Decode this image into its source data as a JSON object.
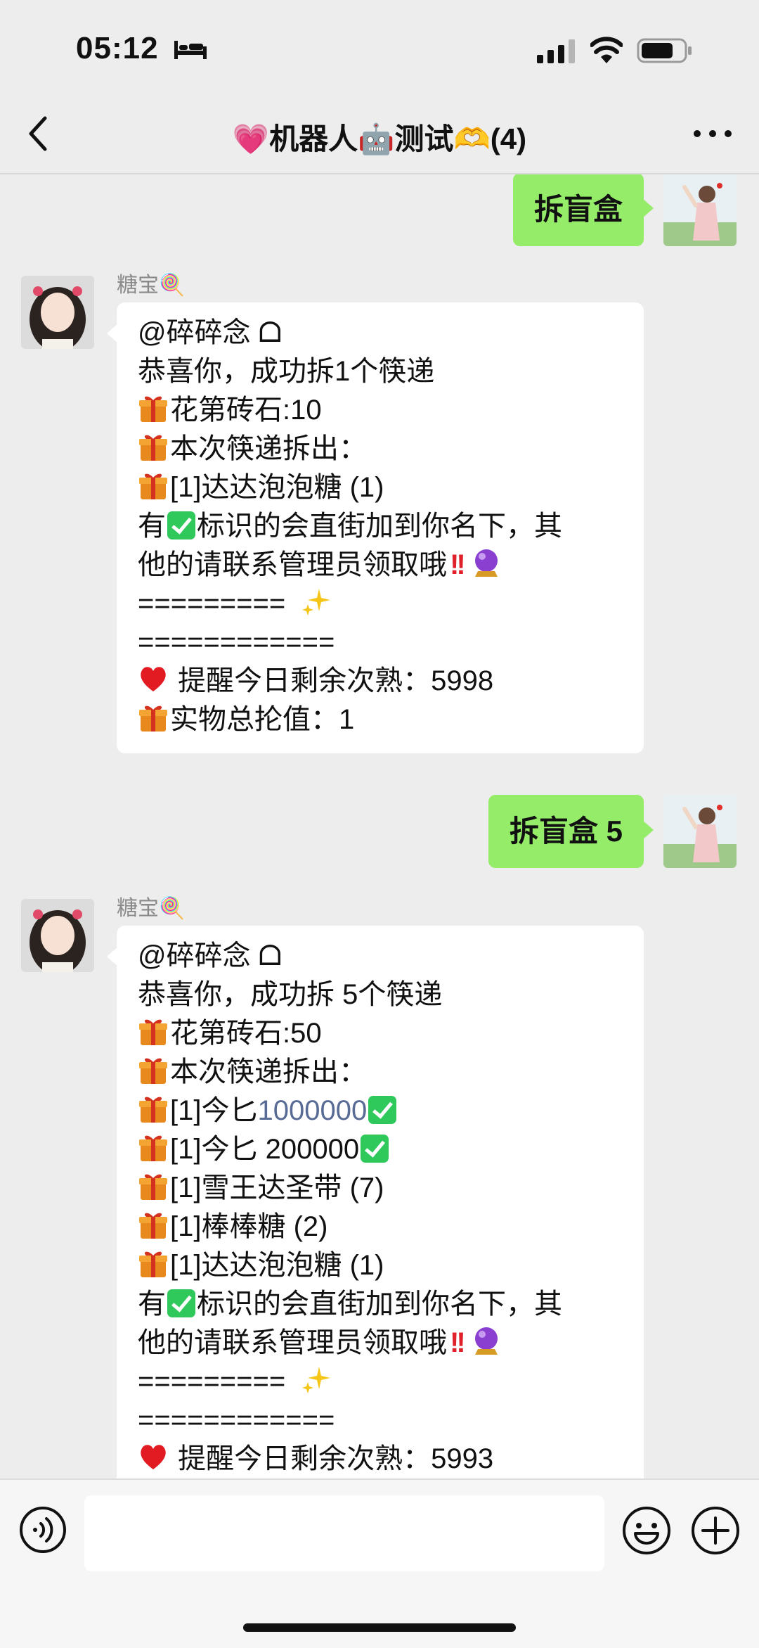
{
  "status": {
    "time": "05:12"
  },
  "nav": {
    "title": "💗机器人🤖测试🫶(4)"
  },
  "messages": [
    {
      "type": "out",
      "text": "拆盲盒"
    },
    {
      "type": "in",
      "sender": "糖宝🍭",
      "lines": [
        "@碎碎念 ᗝ",
        "恭喜你，成功拆1个筷递",
        "花第砖石:10",
        "本次筷递拆出：",
        "[1]达达泡泡糖 (1)",
        "有",
        "标识的会直街加到你名下，其",
        "他的请联系管理员领取哦",
        "=========",
        "============",
        "提醒今日剩余次熟：5998",
        "实物总抡值：1"
      ]
    },
    {
      "type": "out",
      "text": "拆盲盒 5"
    },
    {
      "type": "in",
      "sender": "糖宝🍭",
      "lines": [
        "@碎碎念 ᗝ",
        "恭喜你，成功拆 5个筷递",
        "花第砖石:50",
        "本次筷递拆出：",
        "[1]今匕",
        "1000000",
        "[1]今匕 200000",
        "[1]雪王达圣带 (7)",
        "[1]棒棒糖 (2)",
        "[1]达达泡泡糖 (1)",
        "有",
        "标识的会直街加到你名下，其",
        "他的请联系管理员领取哦",
        "=========",
        "============",
        "提醒今日剩余次熟：5993"
      ]
    }
  ],
  "icons": {
    "gift": "gift-icon",
    "check": "check-mark-icon",
    "heart": "red-heart-icon",
    "sparkles": "sparkles-icon",
    "crystal": "crystal-ball-icon",
    "bangbang": "double-exclamation-icon"
  },
  "colors": {
    "bubble_out": "#95ec69",
    "background": "#ededed",
    "link": "#576b95"
  }
}
